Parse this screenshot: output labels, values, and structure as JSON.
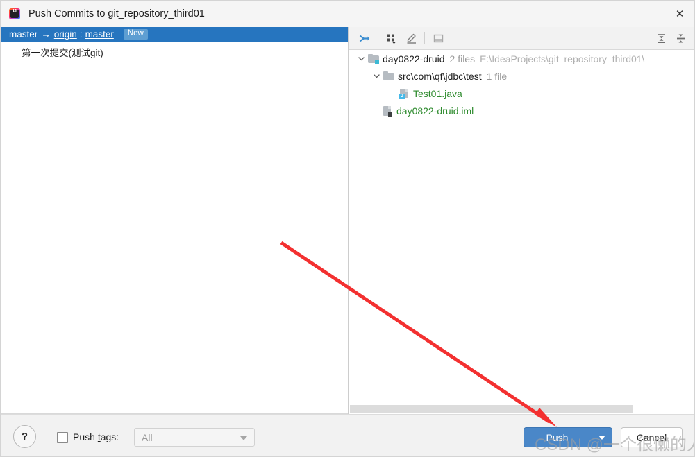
{
  "window": {
    "title": "Push Commits to git_repository_third01",
    "app_icon": "intellij-idea-icon",
    "close_icon": "✕"
  },
  "commits": {
    "branch_row": {
      "source": "master",
      "arrow": "→",
      "remote": "origin",
      "colon": ":",
      "target": "master",
      "badge": "New"
    },
    "items": [
      {
        "message": "第一次提交(测试git)"
      }
    ]
  },
  "tree_toolbar": {
    "buttons": [
      {
        "name": "collapse-selection-icon",
        "title": ""
      },
      {
        "name": "group-by-icon",
        "title": ""
      },
      {
        "name": "edit-icon",
        "title": ""
      },
      {
        "name": "preview-diff-icon",
        "title": ""
      },
      {
        "name": "expand-all-icon",
        "title": ""
      },
      {
        "name": "collapse-all-icon",
        "title": ""
      }
    ]
  },
  "tree": {
    "nodes": [
      {
        "label": "day0822-druid",
        "meta": "2 files",
        "path": "E:\\IdeaProjects\\git_repository_third01\\",
        "icon": "folder-modified-icon",
        "expanded": true,
        "indent": 0
      },
      {
        "label": "src\\com\\qf\\jdbc\\test",
        "meta": "1 file",
        "path": "",
        "icon": "folder-icon",
        "expanded": true,
        "indent": 1
      },
      {
        "label": "Test01.java",
        "meta": "",
        "path": "",
        "icon": "java-file-icon",
        "expanded": null,
        "indent": 2
      },
      {
        "label": "day0822-druid.iml",
        "meta": "",
        "path": "",
        "icon": "iml-file-icon",
        "expanded": null,
        "indent": 1
      }
    ]
  },
  "footer": {
    "help_label": "?",
    "push_tags_label_pre": "Push ",
    "push_tags_label_mnemonic": "t",
    "push_tags_label_post": "ags:",
    "push_tags_checked": false,
    "tags_value": "All",
    "push_label_pre": "P",
    "push_label_mnemonic": "u",
    "push_label_post": "sh",
    "cancel_label": "Cancel"
  },
  "overlay": {
    "watermark": "CSDN @一个很懒的人",
    "arrow_color": "#f33030"
  },
  "colors": {
    "selection_blue": "#2675bf",
    "badge_blue": "#5e9ed2",
    "push_button_blue": "#4a87c8",
    "file_green": "#2e8b2e",
    "muted_gray": "#999999"
  }
}
